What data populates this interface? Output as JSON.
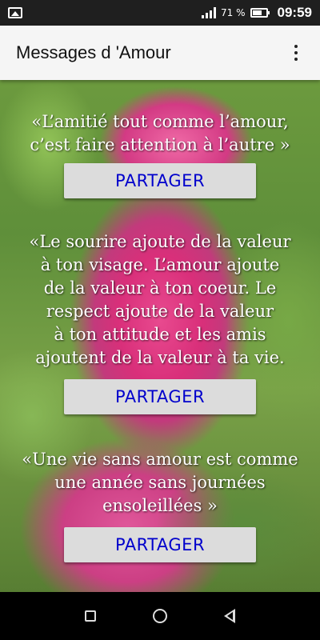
{
  "status_bar": {
    "battery_text": "71 %",
    "battery_level": 0.71,
    "time": "09:59",
    "icons": [
      "image-icon",
      "signal-icon",
      "battery-icon"
    ]
  },
  "app_bar": {
    "title": "Messages d 'Amour",
    "menu_icon": "overflow-menu-icon"
  },
  "quotes": [
    {
      "text": "«L’amitié tout comme l’amour,\nc’est faire attention à l’autre »",
      "button_label": "PARTAGER"
    },
    {
      "text": "«Le sourire ajoute de la valeur\nà ton visage. L’amour ajoute\nde la valeur à ton coeur. Le\nrespect ajoute de la valeur\nà ton attitude et les amis\najoutent de la valeur à ta vie.",
      "button_label": "PARTAGER"
    },
    {
      "text": "«Une vie sans amour est comme\nune année sans journées\nensoleillées »",
      "button_label": "PARTAGER"
    }
  ],
  "nav_bar": {
    "icons": [
      "recents-icon",
      "home-icon",
      "back-icon"
    ]
  },
  "colors": {
    "button_text": "#0000cc",
    "button_bg": "#dcdcdc",
    "app_bar_bg": "#f5f5f5",
    "status_bar_bg": "#1f1f1f"
  }
}
